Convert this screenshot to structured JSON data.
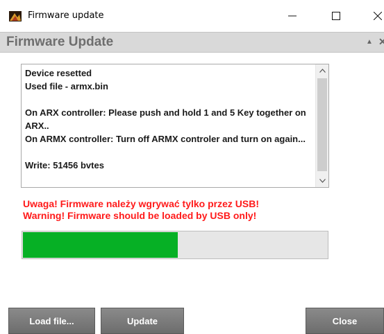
{
  "window": {
    "title": "Firmware update",
    "controls": {
      "minimize": "minimize-icon",
      "maximize": "maximize-icon",
      "close": "close-icon"
    }
  },
  "header": {
    "title": "Firmware Update",
    "collapse_icon": "triangle-up-icon",
    "close_icon": "close-icon"
  },
  "log": {
    "lines": [
      "Device resetted",
      "Used file - armx.bin",
      "",
      "On ARX controller: Please push and hold 1 and 5 Key together on ARX..",
      "On ARMX controller: Turn off ARMX controler and turn on again...",
      "",
      "Write: 51456 bvtes"
    ]
  },
  "warning": {
    "line1": "Uwaga! Firmware należy wgrywać tylko przez USB!",
    "line2": "Warning! Firmware should be loaded by USB only!",
    "color": "#ff1a1a"
  },
  "progress": {
    "fraction": 0.51,
    "fill_color": "#06b025"
  },
  "buttons": {
    "load_label": "Load file...",
    "update_label": "Update",
    "close_label": "Close"
  }
}
